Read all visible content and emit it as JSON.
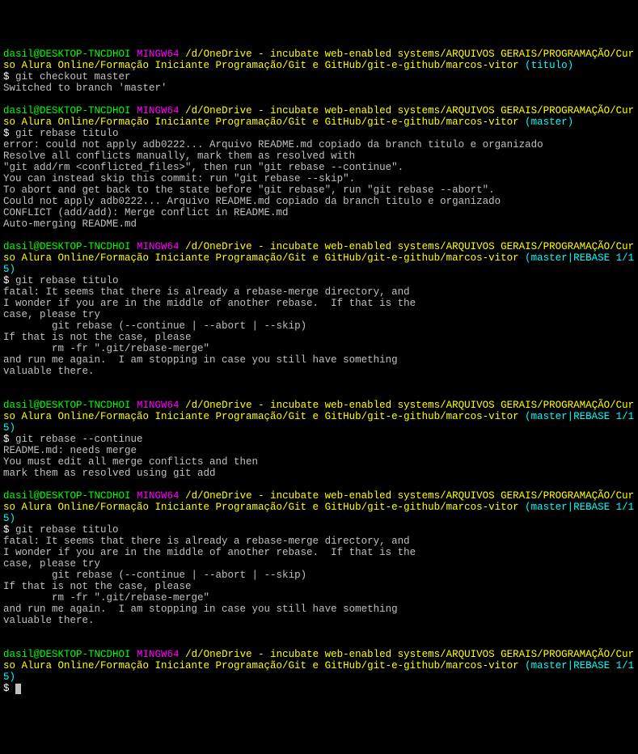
{
  "prompt_user": "dasil@DESKTOP-TNCDHOI",
  "prompt_host": "MINGW64",
  "prompt_path": "/d/OneDrive - incubate web-enabled systems/ARQUIVOS GERAIS/PROGRAMAÇÃO/Curso Alura Online/Formação Iniciante Programação/Git e GitHub/git-e-github/marcos-vitor",
  "branch_titulo": "(titulo)",
  "branch_master": "(master)",
  "branch_rebase": "(master|REBASE 1/15)",
  "dollar": "$",
  "blocks": {
    "b1": {
      "cmd": "git checkout master",
      "out1": "Switched to branch 'master'"
    },
    "b2": {
      "cmd": "git rebase titulo",
      "out1": "error: could not apply adb0222... Arquivo README.md copiado da branch titulo e organizado",
      "out2": "Resolve all conflicts manually, mark them as resolved with",
      "out3": "\"git add/rm <conflicted_files>\", then run \"git rebase --continue\".",
      "out4": "You can instead skip this commit: run \"git rebase --skip\".",
      "out5": "To abort and get back to the state before \"git rebase\", run \"git rebase --abort\".",
      "out6": "Could not apply adb0222... Arquivo README.md copiado da branch titulo e organizado",
      "out7": "CONFLICT (add/add): Merge conflict in README.md",
      "out8": "Auto-merging README.md"
    },
    "b3": {
      "cmd": "git rebase titulo",
      "out1": "fatal: It seems that there is already a rebase-merge directory, and",
      "out2": "I wonder if you are in the middle of another rebase.  If that is the",
      "out3": "case, please try",
      "out4": "        git rebase (--continue | --abort | --skip)",
      "out5": "If that is not the case, please",
      "out6": "        rm -fr \".git/rebase-merge\"",
      "out7": "and run me again.  I am stopping in case you still have something",
      "out8": "valuable there."
    },
    "b4": {
      "cmd": "git rebase --continue",
      "out1": "README.md: needs merge",
      "out2": "You must edit all merge conflicts and then",
      "out3": "mark them as resolved using git add"
    },
    "b5": {
      "cmd": "git rebase titulo",
      "out1": "fatal: It seems that there is already a rebase-merge directory, and",
      "out2": "I wonder if you are in the middle of another rebase.  If that is the",
      "out3": "case, please try",
      "out4": "        git rebase (--continue | --abort | --skip)",
      "out5": "If that is not the case, please",
      "out6": "        rm -fr \".git/rebase-merge\"",
      "out7": "and run me again.  I am stopping in case you still have something",
      "out8": "valuable there."
    },
    "b6": {
      "cmd": ""
    }
  }
}
